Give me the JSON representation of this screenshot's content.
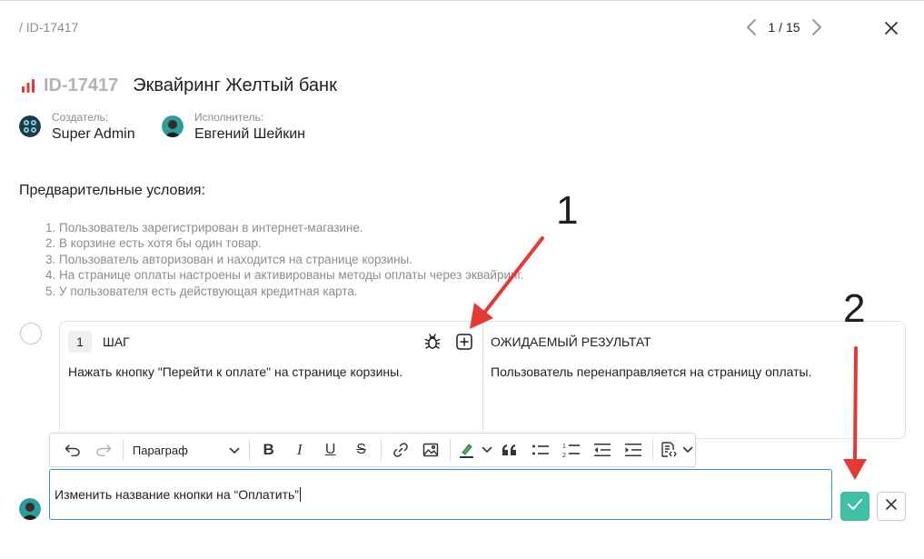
{
  "header": {
    "breadcrumb": "/ ID-17417",
    "pager_text": "1 / 15"
  },
  "task": {
    "id": "ID-17417",
    "title": "Эквайринг Желтый банк",
    "priority_color": "#e53935"
  },
  "creator": {
    "role": "Создатель:",
    "name": "Super Admin"
  },
  "assignee": {
    "role": "Исполнитель:",
    "name": "Евгений Шейкин"
  },
  "preconditions": {
    "heading": "Предварительные условия:",
    "items": [
      "1. Пользователь зарегистрирован в интернет-магазине.",
      "2. В корзине есть хотя бы один товар.",
      "3. Пользователь авторизован и находится на странице корзины.",
      "4. На странице оплаты настроены и активированы методы оплаты через эквайринг.",
      "5. У пользователя есть действующая кредитная карта."
    ]
  },
  "step": {
    "number": "1",
    "step_label": "ШАГ",
    "step_text": "Нажать кнопку \"Перейти к оплате\" на странице корзины.",
    "result_label": "ОЖИДАЕМЫЙ РЕЗУЛЬТАТ",
    "result_text": "Пользователь перенаправляется на страницу оплаты."
  },
  "toolbar": {
    "paragraph_label": "Параграф",
    "bold_label": "B",
    "italic_label": "I",
    "underline_label": "U",
    "strike_label": "S",
    "highlight_color": "#4caf50"
  },
  "comment": {
    "value": "Изменить название кнопки на “Оплатить”"
  },
  "annotations": {
    "label_1": "1",
    "label_2": "2",
    "arrow_color": "#e53935"
  },
  "colors": {
    "accent": "#3fbfa3",
    "focus_border": "#3a8fd6"
  }
}
